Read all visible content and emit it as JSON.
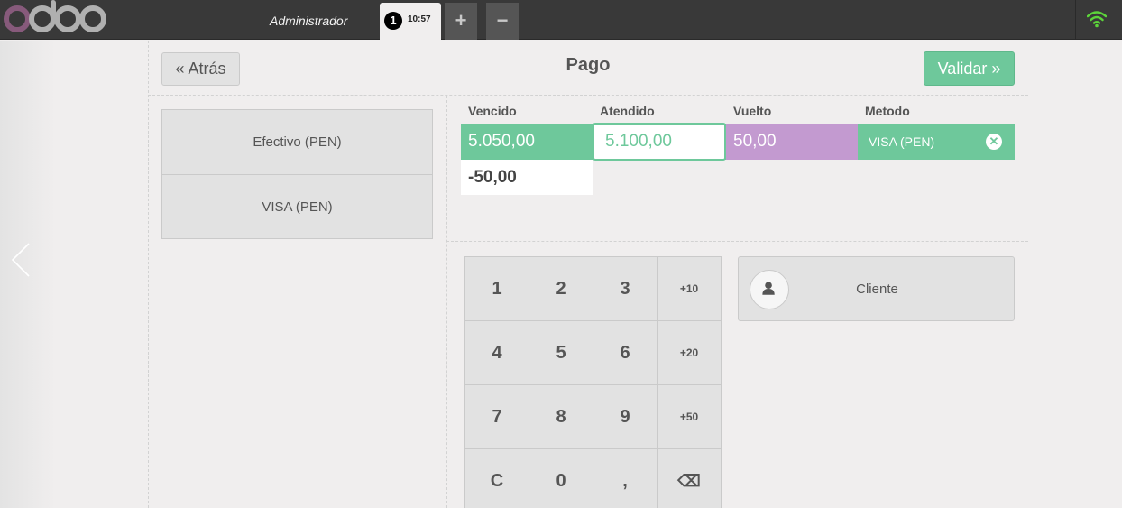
{
  "topbar": {
    "user": "Administrador",
    "order_number": "1",
    "order_time": "10:57",
    "add_order": "+",
    "remove_order": "−",
    "icons": {
      "logo": "odoo-logo",
      "wifi": "wifi-icon"
    },
    "wifi_color": "#5cd43a"
  },
  "header": {
    "back_label": "« Atrás",
    "title": "Pago",
    "validate_label": "Validar »"
  },
  "payment_methods": [
    "Efectivo (PEN)",
    "VISA (PEN)"
  ],
  "paymentlines": {
    "headers": {
      "due": "Vencido",
      "tendered": "Atendido",
      "change": "Vuelto",
      "method": "Metodo"
    },
    "line": {
      "due": "5.050,00",
      "tendered": "5.100,00",
      "change": "50,00",
      "method": "VISA (PEN)"
    },
    "remaining": "-50,00"
  },
  "numpad": {
    "keys": [
      "1",
      "2",
      "3",
      "+10",
      "4",
      "5",
      "6",
      "+20",
      "7",
      "8",
      "9",
      "+50",
      "C",
      "0",
      ",",
      "⌫"
    ]
  },
  "customer": {
    "label": "Cliente",
    "icon": "user-icon"
  },
  "colors": {
    "accent": "#6ec89b",
    "change": "#c39ad0",
    "topbar": "#393939",
    "brand": "#875a7b"
  }
}
